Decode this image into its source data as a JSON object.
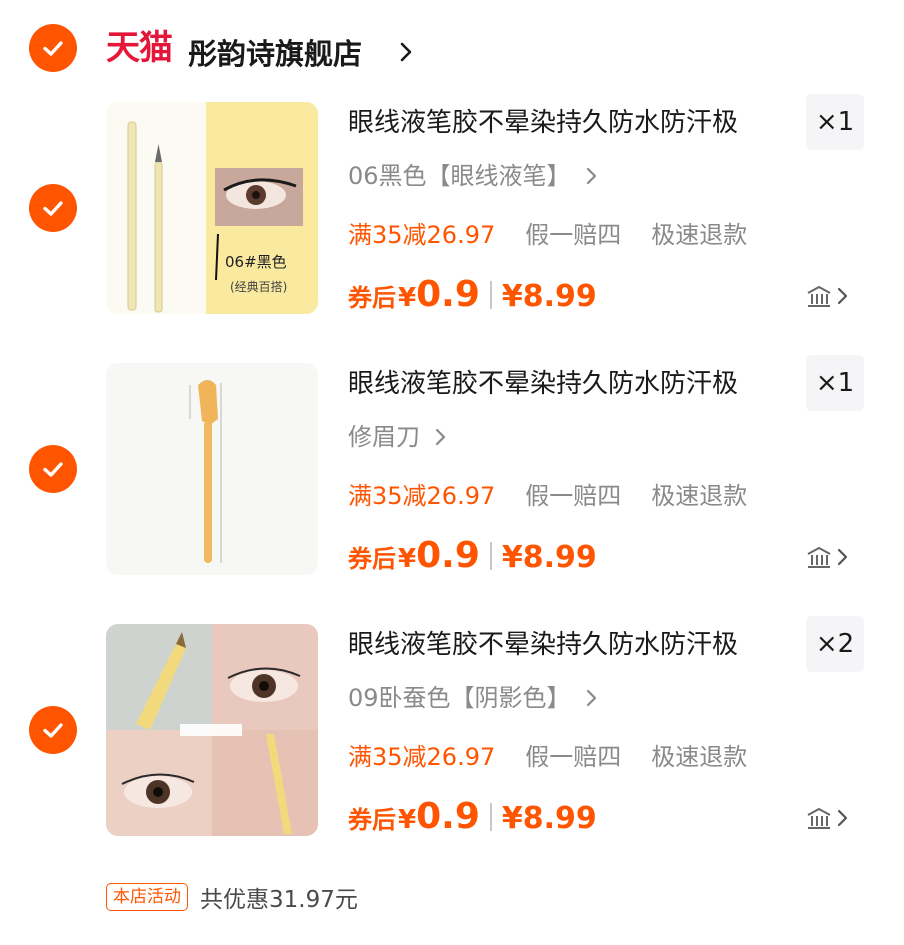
{
  "shop": {
    "platform_logo": "天猫",
    "name": "彤韵诗旗舰店",
    "selected": true,
    "icons": {
      "checkbox": "checkmark-circle-icon",
      "chevron": "chevron-right-icon"
    }
  },
  "items": [
    {
      "selected": true,
      "title": "眼线液笔胶不晕染持久防水防汗极",
      "quantity": "×1",
      "sku": "06黑色【眼线液笔】",
      "promo_discount": "满35减26.97",
      "tags": [
        "假一赔四",
        "极速退款"
      ],
      "price_label": "券后",
      "currency": "¥",
      "price_after": "0.9",
      "price_original": "¥8.99",
      "thumb_caption_1": "06#黑色",
      "thumb_caption_2": "(经典百搭)"
    },
    {
      "selected": true,
      "title": "眼线液笔胶不晕染持久防水防汗极",
      "quantity": "×1",
      "sku": "修眉刀",
      "promo_discount": "满35减26.97",
      "tags": [
        "假一赔四",
        "极速退款"
      ],
      "price_label": "券后",
      "currency": "¥",
      "price_after": "0.9",
      "price_original": "¥8.99"
    },
    {
      "selected": true,
      "title": "眼线液笔胶不晕染持久防水防汗极",
      "quantity": "×2",
      "sku": "09卧蚕色【阴影色】",
      "promo_discount": "满35减26.97",
      "tags": [
        "假一赔四",
        "极速退款"
      ],
      "price_label": "券后",
      "currency": "¥",
      "price_after": "0.9",
      "price_original": "¥8.99"
    }
  ],
  "footer": {
    "badge": "本店活动",
    "saving_text": "共优惠31.97元"
  },
  "colors": {
    "accent": "#ff5500",
    "tmall_red": "#e4173b",
    "text_primary": "#1a1a1a",
    "text_secondary": "#8a8a8a",
    "qty_bg": "#f5f5f7"
  }
}
